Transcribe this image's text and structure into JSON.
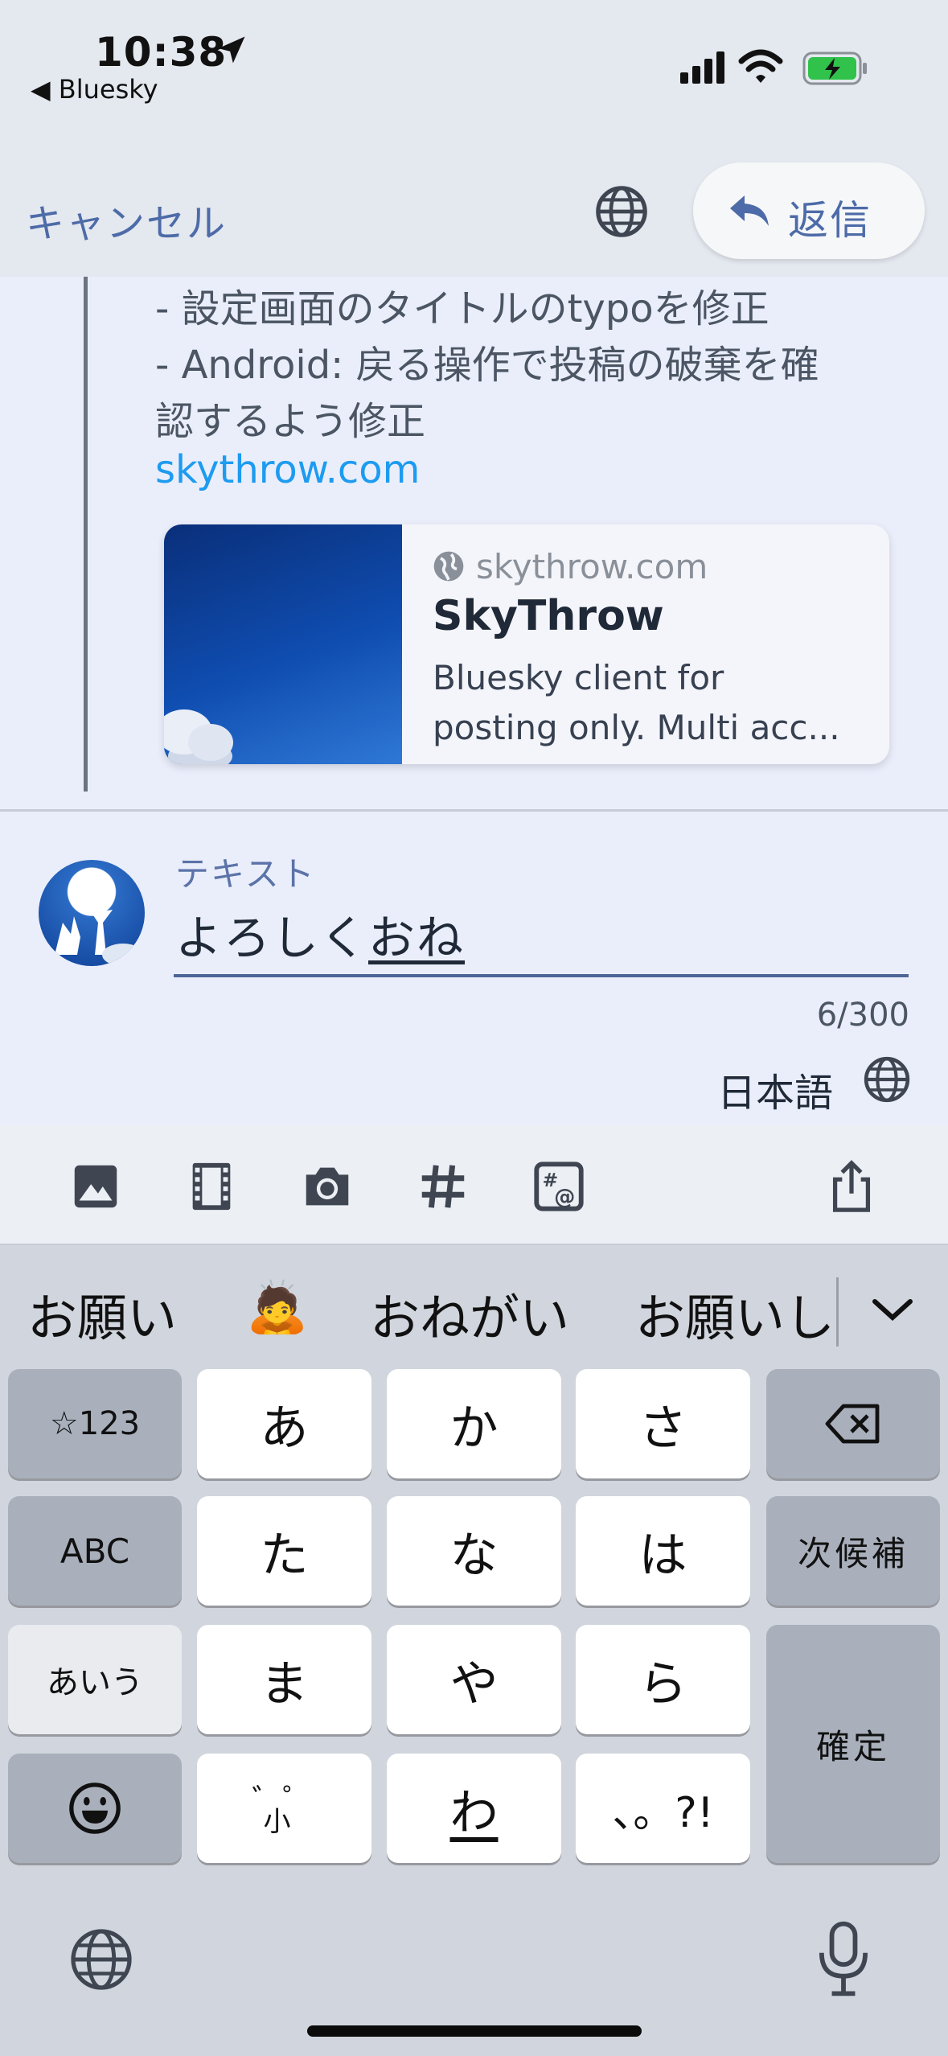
{
  "status_bar": {
    "time": "10:38",
    "back_app": "◀ Bluesky"
  },
  "header": {
    "cancel_label": "キャンセル",
    "reply_label": "返信"
  },
  "quoted_post": {
    "lines": [
      "- 設定画面のタイトルのtypoを修正",
      "- Android: 戻る操作で投稿の破棄を確",
      "認するよう修正"
    ],
    "link_text": "skythrow.com",
    "card": {
      "domain": "skythrow.com",
      "title": "SkyThrow",
      "description_line1": "Bluesky client for",
      "description_line2": "posting only. Multi acc..."
    }
  },
  "compose": {
    "field_label": "テキスト",
    "text_committed": "よろしく",
    "text_marked": "おね",
    "counter": "6/300",
    "language": "日本語"
  },
  "toolbar": {
    "icons": [
      "image-icon",
      "video-icon",
      "camera-icon",
      "hashtag-icon",
      "mention-icon",
      "share-icon"
    ]
  },
  "keyboard": {
    "candidates": [
      "お願い",
      "🙇",
      "おねがい",
      "お願いし"
    ],
    "keys": {
      "symbols": "☆123",
      "a": "あ",
      "ka": "か",
      "sa": "さ",
      "abc": "ABC",
      "ta": "た",
      "na": "な",
      "ha": "は",
      "next_candidate": "次候補",
      "aiu": "あいう",
      "ma": "ま",
      "ya": "や",
      "ra": "ら",
      "confirm": "確定",
      "dakuten": "゛゜",
      "small_kana": "小",
      "wa": "わ",
      "punctuation": "、。?!"
    }
  },
  "colors": {
    "accent": "#4d6ba8",
    "link": "#1d9bf0",
    "compose_bg": "#eaeefb"
  }
}
